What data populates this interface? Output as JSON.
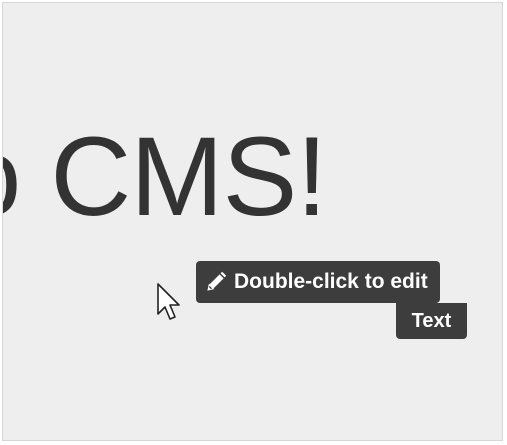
{
  "page": {
    "headline": "o CMS!",
    "tooltip": {
      "icon": "pencil-icon",
      "label": "Double-click to edit",
      "sub_label": "Text"
    },
    "cursor": "arrow-cursor-icon"
  },
  "colors": {
    "background": "#eeeeee",
    "headline_text": "#333333",
    "tooltip_background": "#3d3d3d",
    "tooltip_text": "#ffffff"
  }
}
